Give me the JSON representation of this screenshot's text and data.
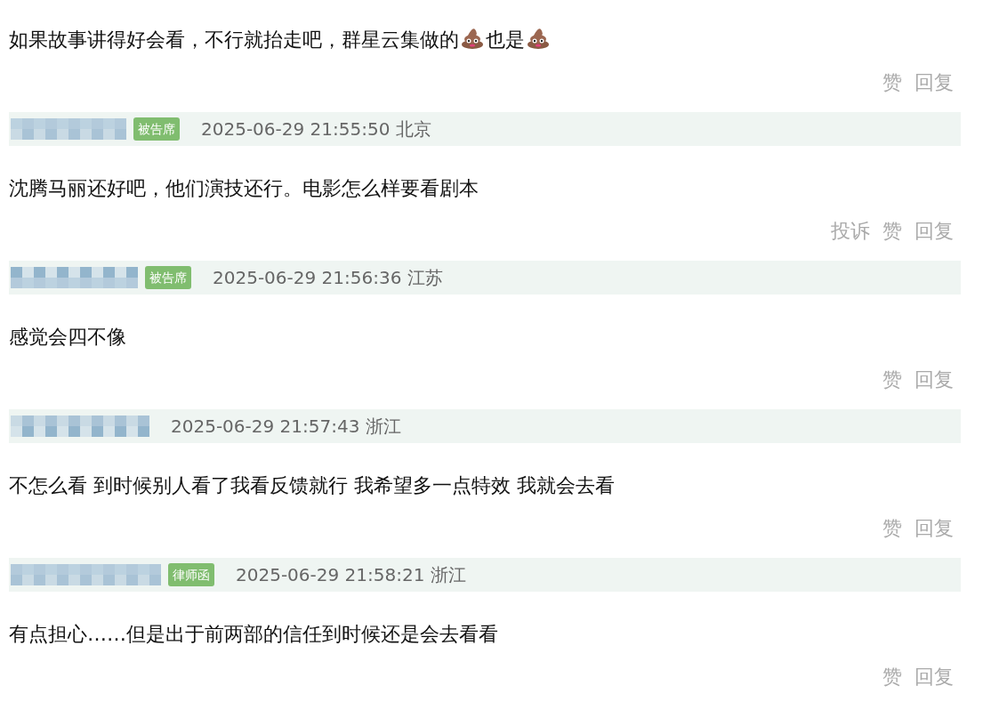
{
  "comments": [
    {
      "segments": [
        {
          "kind": "text",
          "text": "如果故事讲得好会看，不行就抬走吧，群星云集做的"
        },
        {
          "kind": "emoji"
        },
        {
          "kind": "text",
          "text": "也是"
        },
        {
          "kind": "emoji"
        }
      ],
      "actions": [
        "赞",
        "回复"
      ]
    },
    {
      "header": {
        "badge": "被告席",
        "time": "2025-06-29 21:55:50 北京"
      },
      "segments": [
        {
          "kind": "text",
          "text": "沈腾马丽还好吧，他们演技还行。电影怎么样要看剧本"
        }
      ],
      "actions": [
        "投诉",
        "赞",
        "回复"
      ]
    },
    {
      "header": {
        "badge": "被告席",
        "time": "2025-06-29 21:56:36 江苏"
      },
      "segments": [
        {
          "kind": "text",
          "text": "感觉会四不像"
        }
      ],
      "actions": [
        "赞",
        "回复"
      ]
    },
    {
      "header": {
        "time": "2025-06-29 21:57:43 浙江"
      },
      "segments": [
        {
          "kind": "text",
          "text": "不怎么看 到时候别人看了我看反馈就行 我希望多一点特效 我就会去看"
        }
      ],
      "actions": [
        "赞",
        "回复"
      ]
    },
    {
      "header": {
        "badge": "律师函",
        "time": "2025-06-29 21:58:21 浙江"
      },
      "segments": [
        {
          "kind": "text",
          "text": "有点担心……但是出于前两部的信任到时候还是会去看看"
        }
      ],
      "actions": [
        "赞",
        "回复"
      ]
    }
  ]
}
